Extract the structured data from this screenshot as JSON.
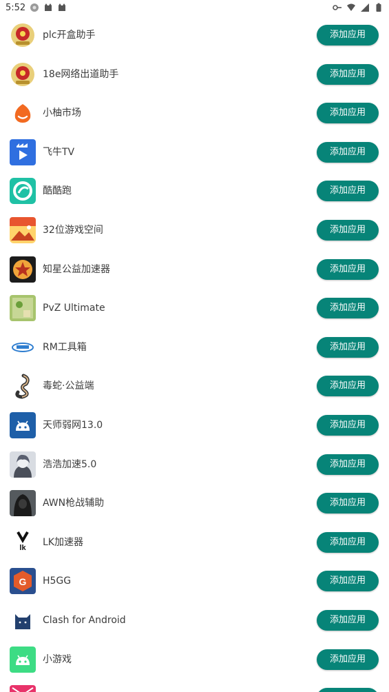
{
  "statusbar": {
    "time": "5:52",
    "left_icons": [
      "system-gear-icon",
      "android-cat-icon",
      "android-cat-icon"
    ],
    "right_icons": [
      "key-icon",
      "wifi-icon",
      "signal-icon",
      "battery-icon"
    ]
  },
  "button_color": "#078478",
  "apps": [
    {
      "name": "plc开盒助手",
      "button": "添加应用",
      "icon": "police-emblem-icon",
      "color": "#d4b25a"
    },
    {
      "name": "18e网络出道助手",
      "button": "添加应用",
      "icon": "police-emblem-icon",
      "color": "#d4b25a"
    },
    {
      "name": "小柚市场",
      "button": "添加应用",
      "icon": "orange-smile-icon",
      "color": "#f26a21"
    },
    {
      "name": "飞牛TV",
      "button": "添加应用",
      "icon": "feiniu-tv-icon",
      "color": "#2f6fe0"
    },
    {
      "name": "酷酷跑",
      "button": "添加应用",
      "icon": "kukupao-icon",
      "color": "#1fc1a5"
    },
    {
      "name": "32位游戏空间",
      "button": "添加应用",
      "icon": "game-space-icon",
      "color": "#f3a430"
    },
    {
      "name": "知星公益加速器",
      "button": "添加应用",
      "icon": "star-badge-icon",
      "color": "#2a2a2a"
    },
    {
      "name": "PvZ Ultimate",
      "button": "添加应用",
      "icon": "pvz-icon",
      "color": "#8fb25a"
    },
    {
      "name": "RM工具箱",
      "button": "添加应用",
      "icon": "rm-toolbox-icon",
      "color": "#2f7ed0"
    },
    {
      "name": "毒蛇·公益端",
      "button": "添加应用",
      "icon": "snake-icon",
      "color": "#444444"
    },
    {
      "name": "天师弱网13.0",
      "button": "添加应用",
      "icon": "android-robot-icon",
      "color": "#1e5fa8"
    },
    {
      "name": "浩浩加速5.0",
      "button": "添加应用",
      "icon": "anime-avatar-icon",
      "color": "#9aa0aa"
    },
    {
      "name": "AWN枪战辅助",
      "button": "添加应用",
      "icon": "hooded-figure-icon",
      "color": "#333333"
    },
    {
      "name": "LK加速器",
      "button": "添加应用",
      "icon": "lk-logo-icon",
      "color": "#111111"
    },
    {
      "name": "H5GG",
      "button": "添加应用",
      "icon": "h5gg-icon",
      "color": "#2a4f8f"
    },
    {
      "name": "Clash for Android",
      "button": "添加应用",
      "icon": "clash-cat-icon",
      "color": "#23406e"
    },
    {
      "name": "小游戏",
      "button": "添加应用",
      "icon": "android-robot-icon",
      "color": "#3ddc84"
    },
    {
      "name": "",
      "button": "添加应用",
      "icon": "partial-app-icon",
      "color": "#e8336a"
    }
  ]
}
